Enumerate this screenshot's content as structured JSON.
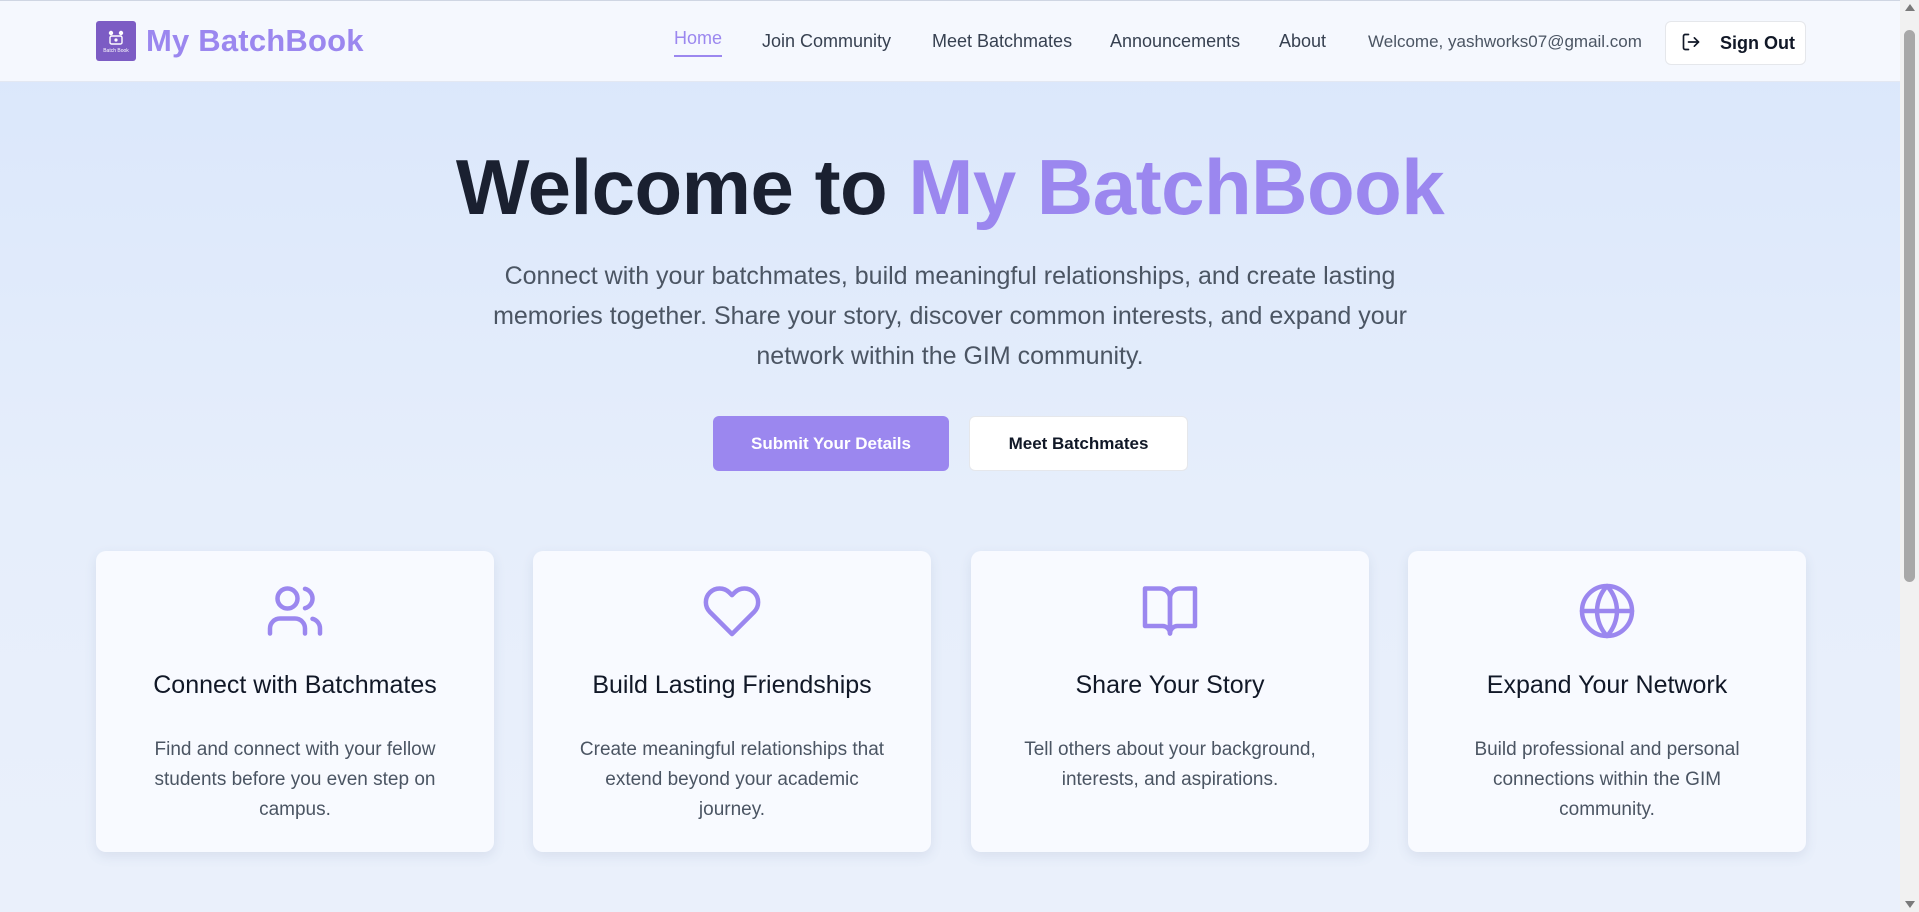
{
  "header": {
    "brand": "My BatchBook",
    "logo_caption": "Batch Book",
    "nav": [
      {
        "label": "Home",
        "active": true
      },
      {
        "label": "Join Community"
      },
      {
        "label": "Meet Batchmates"
      },
      {
        "label": "Announcements"
      },
      {
        "label": "About"
      }
    ],
    "welcome": "Welcome, yashworks07@gmail.com",
    "signout_label": "Sign Out"
  },
  "hero": {
    "title_prefix": "Welcome to ",
    "title_brand": "My BatchBook",
    "subtitle": "Connect with your batchmates, build meaningful relationships, and create lasting memories together. Share your story, discover common interests, and expand your network within the GIM community.",
    "primary_button": "Submit Your Details",
    "secondary_button": "Meet Batchmates"
  },
  "cards": [
    {
      "icon": "users-icon",
      "title": "Connect with Batchmates",
      "text": "Find and connect with your fellow students before you even step on campus."
    },
    {
      "icon": "heart-icon",
      "title": "Build Lasting Friendships",
      "text": "Create meaningful relationships that extend beyond your academic journey."
    },
    {
      "icon": "book-open-icon",
      "title": "Share Your Story",
      "text": "Tell others about your background, interests, and aspirations."
    },
    {
      "icon": "globe-icon",
      "title": "Expand Your Network",
      "text": "Build professional and personal connections within the GIM community."
    }
  ],
  "colors": {
    "accent": "#9b87ef",
    "logo_bg": "#7c5cc4",
    "heading": "#1a2030",
    "body_text": "#4b5563"
  }
}
